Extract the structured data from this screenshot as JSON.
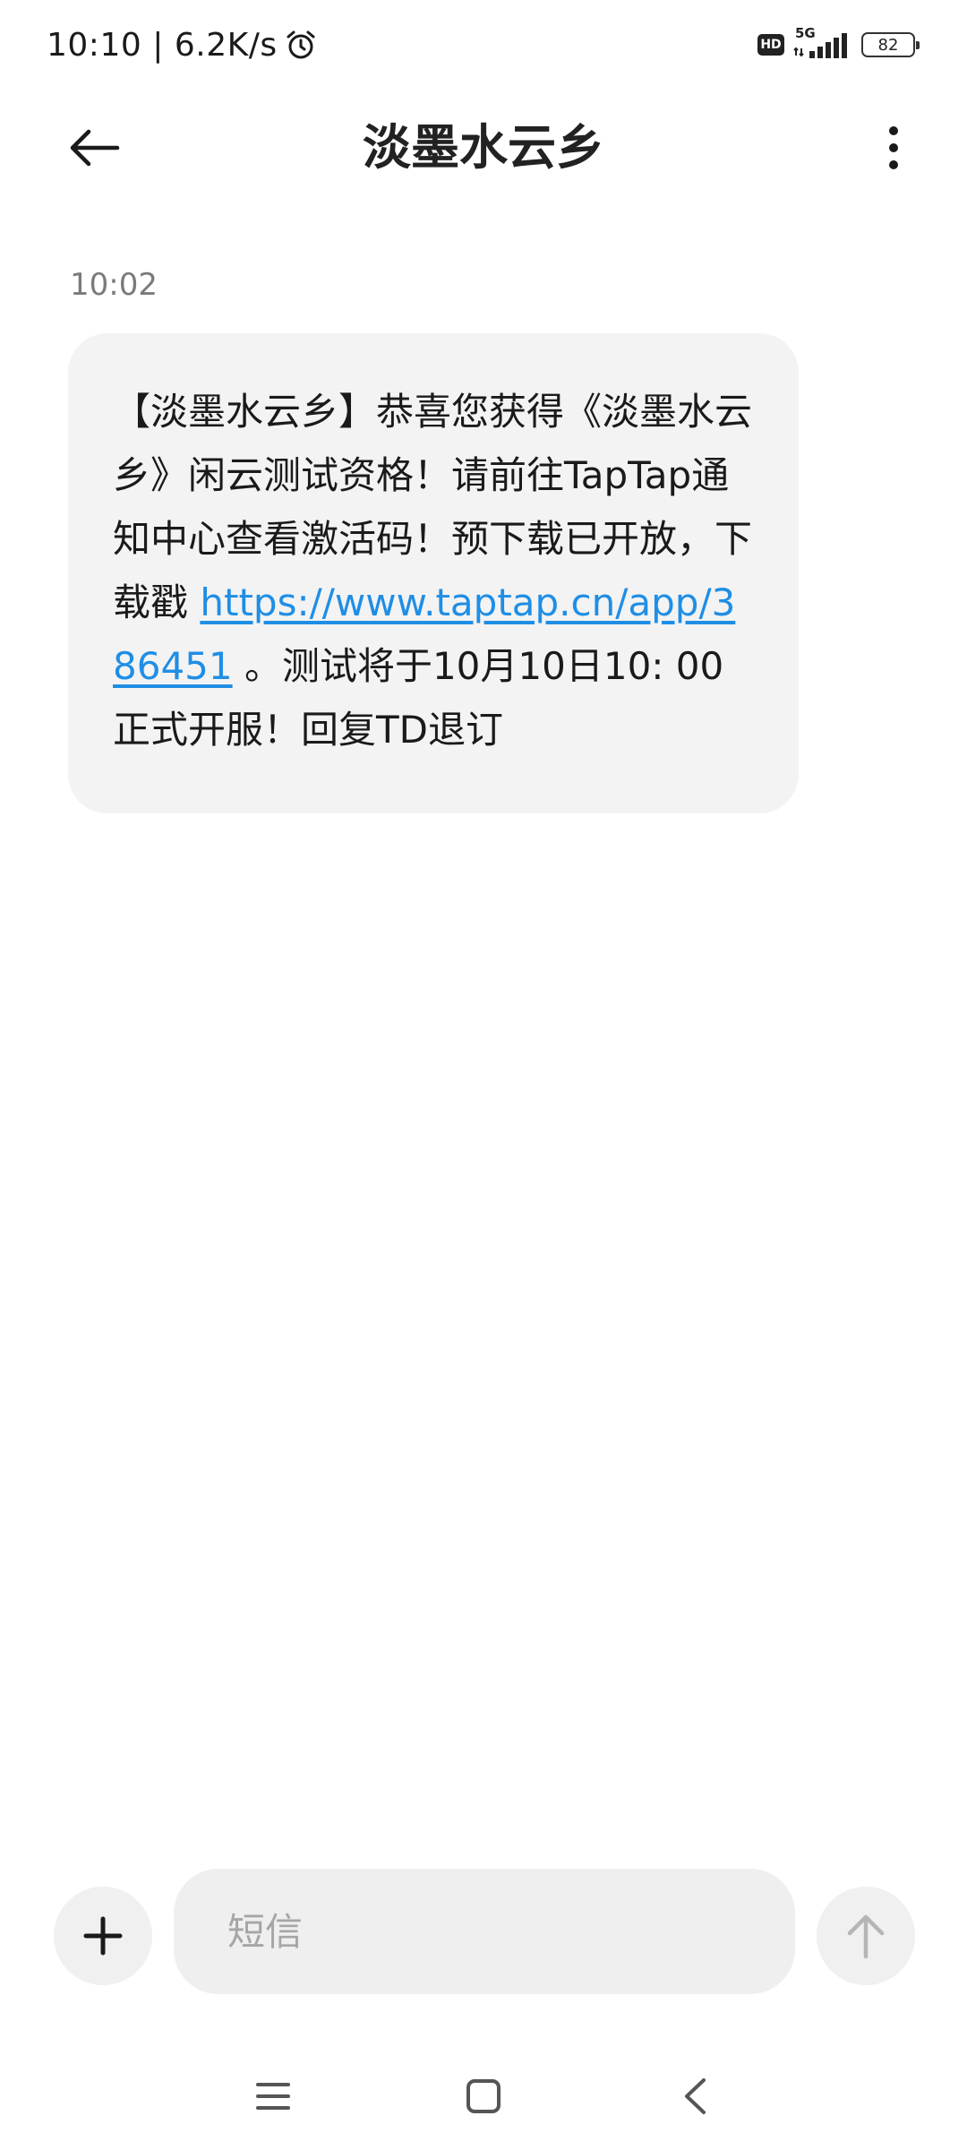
{
  "status_bar": {
    "time": "10:10",
    "separator": "|",
    "net_speed": "6.2K/s",
    "alarm_icon": "alarm-clock-icon",
    "hd_label": "HD",
    "network_type": "5G",
    "battery_level": "82"
  },
  "header": {
    "title": "淡墨水云乡",
    "back_icon": "arrow-left-icon",
    "more_icon": "more-vertical-icon"
  },
  "conversation": {
    "messages": [
      {
        "timestamp": "10:02",
        "text_before_link": "【淡墨水云乡】恭喜您获得《淡墨水云乡》闲云测试资格！请前往TapTap通知中心查看激活码！预下载已开放，下载戳 ",
        "link_text": "https://www.taptap.cn/app/386451",
        "text_after_link": " 。测试将于10月10日10: 00正式开服！回复TD退订"
      }
    ]
  },
  "compose": {
    "placeholder": "短信",
    "attach_icon": "plus-icon",
    "send_icon": "arrow-up-icon"
  },
  "nav_bar": {
    "menu_icon": "menu-icon",
    "home_icon": "square-home-icon",
    "back_icon": "chevron-left-icon"
  },
  "colors": {
    "link": "#1f8ee5",
    "bubble_bg": "#f3f3f3",
    "input_bg": "#efefef",
    "text": "#1a1a1a",
    "muted": "#7a7a7a"
  }
}
